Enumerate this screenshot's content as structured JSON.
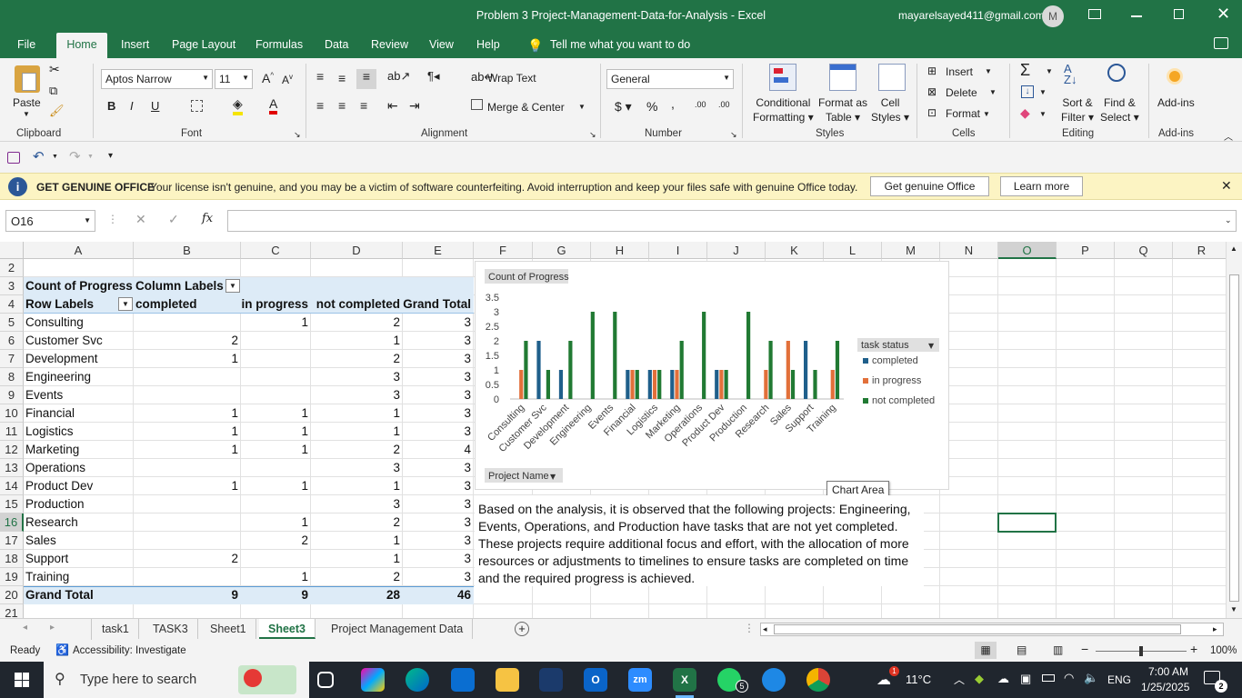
{
  "window": {
    "title": "Problem 3 Project-Management-Data-for-Analysis  -  Excel",
    "account": "mayarelsayed411@gmail.com",
    "avatar_initial": "M"
  },
  "menu_tabs": [
    "File",
    "Home",
    "Insert",
    "Page Layout",
    "Formulas",
    "Data",
    "Review",
    "View",
    "Help"
  ],
  "tell_me": "Tell me what you want to do",
  "ribbon": {
    "paste": "Paste",
    "clipboard": "Clipboard",
    "font_name": "Aptos Narrow",
    "font_size": "11",
    "font": "Font",
    "wrap_text": "Wrap Text",
    "merge_center": "Merge & Center",
    "alignment": "Alignment",
    "number_format": "General",
    "number": "Number",
    "conditional_formatting": [
      "Conditional",
      "Formatting"
    ],
    "format_as_table": [
      "Format as",
      "Table"
    ],
    "cell_styles": [
      "Cell",
      "Styles"
    ],
    "styles": "Styles",
    "insert": "Insert",
    "delete": "Delete",
    "format": "Format",
    "cells": "Cells",
    "sort_filter": [
      "Sort &",
      "Filter"
    ],
    "find_select": [
      "Find &",
      "Select"
    ],
    "editing": "Editing",
    "addins": "Add-ins",
    "addins_group": "Add-ins"
  },
  "infobar": {
    "title": "GET GENUINE OFFICE",
    "message": "Your license isn't genuine, and you may be a victim of software counterfeiting. Avoid interruption and keep your files safe with genuine Office today.",
    "btn_genuine": "Get genuine Office",
    "btn_learn": "Learn more"
  },
  "formula": {
    "name_box": "O16",
    "fx": "fx",
    "content": ""
  },
  "columns": [
    "A",
    "B",
    "C",
    "D",
    "E",
    "F",
    "G",
    "H",
    "I",
    "J",
    "K",
    "L",
    "M",
    "N",
    "O",
    "P",
    "Q",
    "R"
  ],
  "rows": [
    "2",
    "3",
    "4",
    "5",
    "6",
    "7",
    "8",
    "9",
    "10",
    "11",
    "12",
    "13",
    "14",
    "15",
    "16",
    "17",
    "18",
    "19",
    "20",
    "21"
  ],
  "pivot": {
    "header1": "Count of Progress",
    "header2": "Column Labels",
    "row_labels": "Row Labels",
    "col_completed": "completed",
    "col_in_progress": "in progress",
    "col_not_completed": "not completed",
    "col_grand_total": "Grand Total",
    "data": [
      [
        "Consulting",
        "",
        "1",
        "2",
        "3"
      ],
      [
        "Customer Svc",
        "2",
        "",
        "1",
        "3"
      ],
      [
        "Development",
        "1",
        "",
        "2",
        "3"
      ],
      [
        "Engineering",
        "",
        "",
        "3",
        "3"
      ],
      [
        "Events",
        "",
        "",
        "3",
        "3"
      ],
      [
        "Financial",
        "1",
        "1",
        "1",
        "3"
      ],
      [
        "Logistics",
        "1",
        "1",
        "1",
        "3"
      ],
      [
        "Marketing",
        "1",
        "1",
        "2",
        "4"
      ],
      [
        "Operations",
        "",
        "",
        "3",
        "3"
      ],
      [
        "Product Dev",
        "1",
        "1",
        "1",
        "3"
      ],
      [
        "Production",
        "",
        "",
        "3",
        "3"
      ],
      [
        "Research",
        "",
        "1",
        "2",
        "3"
      ],
      [
        "Sales",
        "",
        "2",
        "1",
        "3"
      ],
      [
        "Support",
        "2",
        "",
        "1",
        "3"
      ],
      [
        "Training",
        "",
        "1",
        "2",
        "3"
      ]
    ],
    "grand_total": [
      "Grand Total",
      "9",
      "9",
      "28",
      "46"
    ]
  },
  "chart_data": {
    "type": "bar",
    "title": "Count of Progress",
    "categories": [
      "Consulting",
      "Customer Svc",
      "Development",
      "Engineering",
      "Events",
      "Financial",
      "Logistics",
      "Marketing",
      "Operations",
      "Product Dev",
      "Production",
      "Research",
      "Sales",
      "Support",
      "Training"
    ],
    "series": [
      {
        "name": "completed",
        "color": "#1f5f8b",
        "values": [
          0,
          2,
          1,
          0,
          0,
          1,
          1,
          1,
          0,
          1,
          0,
          0,
          0,
          2,
          0
        ]
      },
      {
        "name": "in progress",
        "color": "#e2703a",
        "values": [
          1,
          0,
          0,
          0,
          0,
          1,
          1,
          1,
          0,
          1,
          0,
          1,
          2,
          0,
          1
        ]
      },
      {
        "name": "not completed",
        "color": "#217a33",
        "values": [
          2,
          1,
          2,
          3,
          3,
          1,
          1,
          2,
          3,
          1,
          3,
          2,
          1,
          1,
          2
        ]
      }
    ],
    "y_ticks": [
      "0",
      "0.5",
      "1",
      "1.5",
      "2",
      "2.5",
      "3",
      "3.5"
    ],
    "ylim": [
      0,
      3.5
    ],
    "legend_title": "task status",
    "axis_field_button": "Project Name",
    "tooltip": "Chart Area"
  },
  "note": "Based on the analysis, it is observed that the following projects: Engineering, Events, Operations, and Production have tasks that are not yet completed. These projects require additional focus and effort, with the allocation of more resources or adjustments to timelines to ensure tasks are completed on time and the required progress is achieved.",
  "sheets": [
    "task1",
    "TASK3",
    "Sheet1",
    "Sheet3",
    "Project Management Data"
  ],
  "active_sheet": "Sheet3",
  "status": {
    "ready": "Ready",
    "accessibility": "Accessibility: Investigate",
    "zoom": "100%"
  },
  "taskbar": {
    "search": "Type here to search",
    "temperature": "11°C",
    "language": "ENG",
    "time": "7:00 AM",
    "date": "1/25/2025",
    "notifications": "2",
    "whatsapp_badge": "5",
    "weather_badge": "1"
  }
}
